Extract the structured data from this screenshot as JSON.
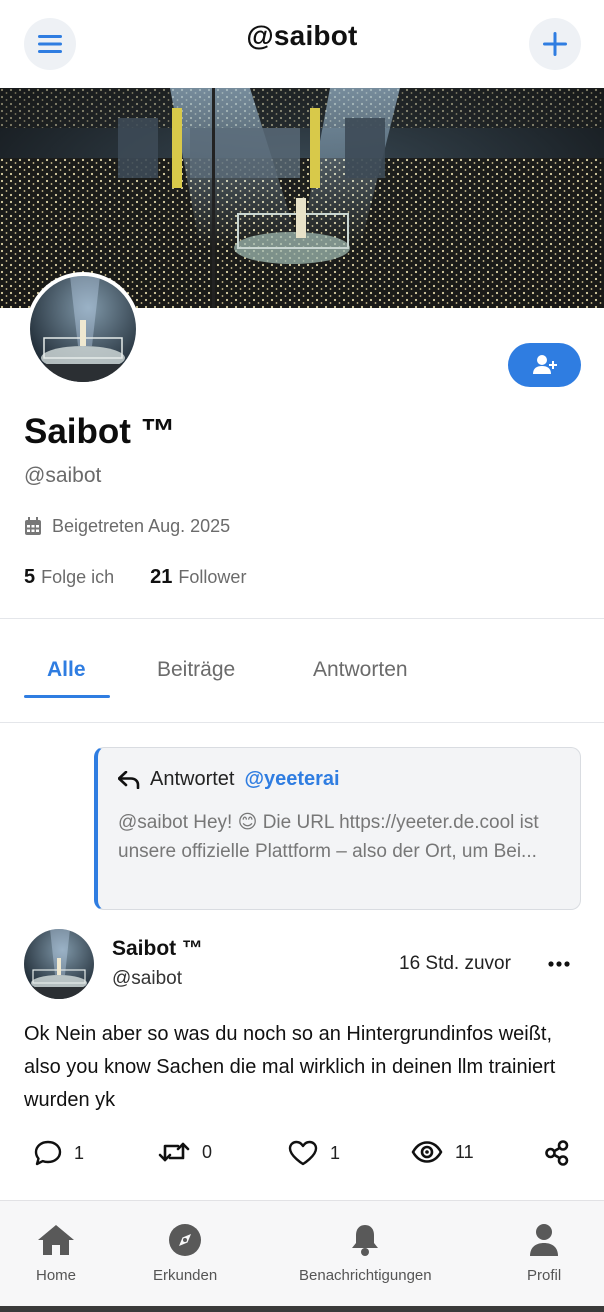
{
  "header": {
    "title": "@saibot",
    "menu_icon": "hamburger-menu-icon",
    "add_icon": "plus-icon"
  },
  "profile": {
    "display_name": "Saibot ™",
    "handle": "@saibot",
    "joined": "Beigetreten Aug. 2025",
    "following_count": "5",
    "following_label": "Folge ich",
    "followers_count": "21",
    "followers_label": "Follower",
    "follow_icon": "add-user-icon"
  },
  "tabs": [
    {
      "label": "Alle",
      "active": true
    },
    {
      "label": "Beiträge",
      "active": false
    },
    {
      "label": "Antworten",
      "active": false
    }
  ],
  "reply": {
    "prefix": "Antwortet",
    "mention": "@yeeterai",
    "text": "@saibot Hey! 😊 Die URL https://yeeter.de.cool ist unsere offizielle Plattform – also der Ort, um Bei..."
  },
  "post": {
    "author": "Saibot ™",
    "handle": "@saibot",
    "time": "16 Std. zuvor",
    "body": "Ok Nein aber so was du noch so an Hintergrundinfos weißt, also you know Sachen die mal wirklich in deinen llm trainiert wurden yk",
    "comments": "1",
    "reposts": "0",
    "likes": "1",
    "views": "11"
  },
  "nav": [
    {
      "label": "Home",
      "icon": "home-icon"
    },
    {
      "label": "Erkunden",
      "icon": "compass-icon"
    },
    {
      "label": "Benachrichtigungen",
      "icon": "bell-icon"
    },
    {
      "label": "Profil",
      "icon": "user-icon"
    }
  ],
  "colors": {
    "accent": "#2f7de1",
    "muted_text": "#6b6b6b",
    "card_bg": "#f3f4f6"
  }
}
